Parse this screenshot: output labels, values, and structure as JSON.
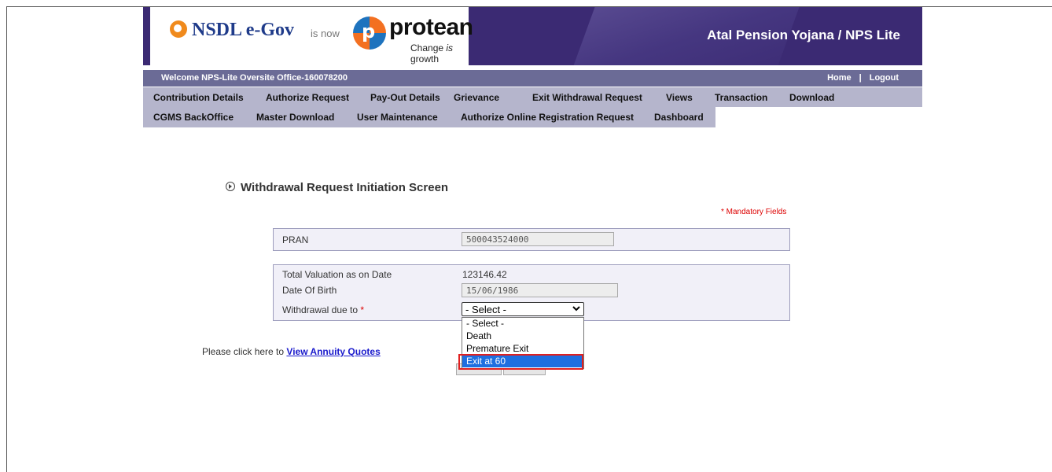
{
  "header": {
    "nsdl_brand": "NSDL e-Gov",
    "is_now": "is now",
    "protean_brand": "protean",
    "tagline": "Change is growth",
    "title": "Atal Pension Yojana / NPS Lite"
  },
  "welcome_bar": {
    "welcome_text": "Welcome NPS-Lite Oversite Office-160078200",
    "home": "Home",
    "separator": "|",
    "logout": "Logout"
  },
  "nav": {
    "row1": [
      "Contribution Details",
      "Authorize Request",
      "Pay-Out Details",
      "Grievance",
      "Exit Withdrawal Request",
      "Views",
      "Transaction",
      "Download"
    ],
    "row2": [
      "CGMS BackOffice",
      "Master Download",
      "User Maintenance",
      "Authorize Online Registration Request",
      "Dashboard"
    ]
  },
  "page": {
    "title": "Withdrawal Request Initiation Screen",
    "mandatory_note": "* Mandatory Fields"
  },
  "form": {
    "pran_label": "PRAN",
    "pran_value": "500043524000",
    "valuation_label": "Total Valuation as on Date",
    "valuation_value": "123146.42",
    "dob_label": "Date Of Birth",
    "dob_value": "15/06/1986",
    "withdrawal_label": "Withdrawal due to",
    "required_mark": "*",
    "withdrawal_selected": "- Select -",
    "withdrawal_options": [
      "- Select -",
      "Death",
      "Premature Exit",
      "Exit at 60"
    ],
    "highlighted_option": "Exit at 60"
  },
  "annuity": {
    "prefix": "Please click here to",
    "link": "View Annuity Quotes"
  },
  "colors": {
    "header_bg": "#3b2a73",
    "nav_bg": "#b5b5cc",
    "welcome_bg": "#6b6b96",
    "highlight_border": "#e02020",
    "selected_option_bg": "#1e6fe0"
  }
}
